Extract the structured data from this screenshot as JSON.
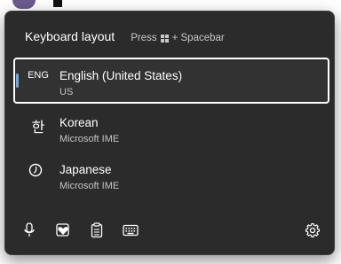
{
  "header": {
    "title": "Keyboard layout",
    "hint_prefix": "Press",
    "hint_suffix": "+ Spacebar"
  },
  "languages": [
    {
      "badge": "ENG",
      "name": "English (United States)",
      "sub": "US",
      "selected": true
    },
    {
      "badge": "한",
      "name": "Korean",
      "sub": "Microsoft IME",
      "selected": false
    },
    {
      "badge": "",
      "name": "Japanese",
      "sub": "Microsoft IME",
      "selected": false
    }
  ],
  "toolbar": {
    "icons": [
      "microphone-icon",
      "emoji-heart-icon",
      "clipboard-icon",
      "keyboard-icon",
      "settings-gear-icon"
    ]
  },
  "colors": {
    "flyout_bg": "#2b2b2b",
    "selected_outline": "#ffffff",
    "accent": "#7aa5d8"
  }
}
